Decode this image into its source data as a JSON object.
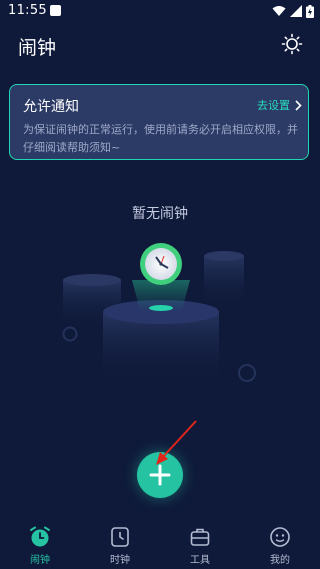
{
  "status_bar": {
    "time": "11:55"
  },
  "header": {
    "title": "闹钟",
    "settings_icon": "sun-settings-icon"
  },
  "notice": {
    "title": "允许通知",
    "action_label": "去设置",
    "body": "为保证闹钟的正常运行，使用前请务必开启相应权限，并仔细阅读帮助须知~"
  },
  "empty_state": {
    "text": "暂无闹钟"
  },
  "fab": {
    "icon": "plus-icon"
  },
  "bottom_nav": {
    "items": [
      {
        "label": "闹钟",
        "icon": "alarm-clock-icon",
        "active": true
      },
      {
        "label": "时钟",
        "icon": "clock-icon",
        "active": false
      },
      {
        "label": "工具",
        "icon": "toolbox-icon",
        "active": false
      },
      {
        "label": "我的",
        "icon": "profile-icon",
        "active": false
      }
    ]
  },
  "colors": {
    "background": "#0f1a3a",
    "accent": "#25c3a1",
    "card": "#2c3b66",
    "arrow": "#e0261b"
  }
}
